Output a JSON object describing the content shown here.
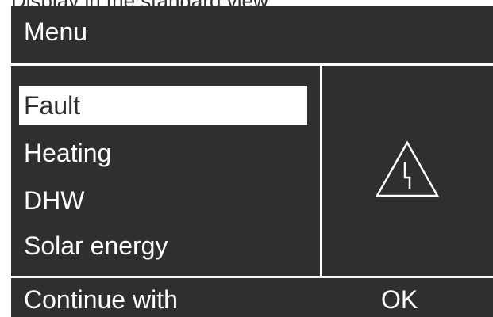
{
  "caption": "Display in the standard view",
  "title": "Menu",
  "menu": {
    "items": [
      {
        "label": "Fault",
        "selected": true
      },
      {
        "label": "Heating",
        "selected": false
      },
      {
        "label": "DHW",
        "selected": false
      },
      {
        "label": "Solar energy",
        "selected": false
      }
    ]
  },
  "icon": "electrical-hazard-warning-icon",
  "footer": {
    "prompt": "Continue with",
    "ok_label": "OK"
  },
  "colors": {
    "screen_background": "#2f2f2f",
    "foreground": "#ffffff"
  }
}
